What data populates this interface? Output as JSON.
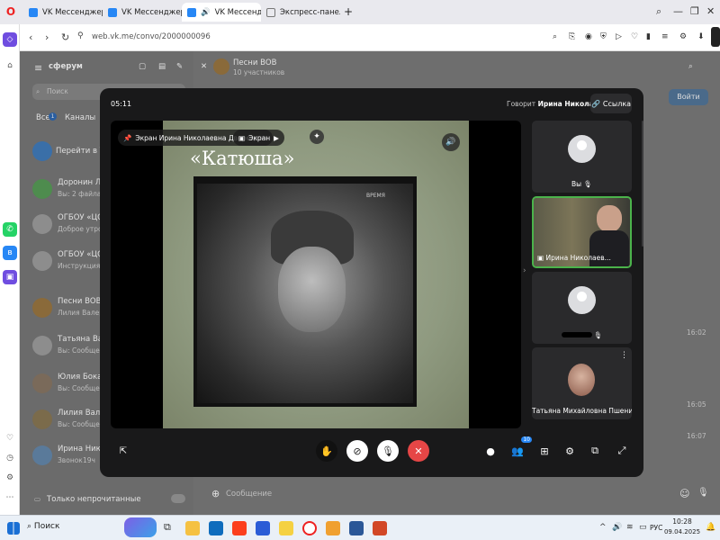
{
  "browser": {
    "tabs": [
      {
        "label": "VK Мессенджер"
      },
      {
        "label": "VK Мессенджер"
      },
      {
        "label": "VK Мессенджер"
      },
      {
        "label": "Экспресс-панель"
      }
    ],
    "url": "web.vk.me/convo/2000000096"
  },
  "vk": {
    "brand": "сферум",
    "search_placeholder": "Поиск",
    "filters": {
      "all": "Все",
      "all_count": "1",
      "channels": "Каналы"
    },
    "go_vk": "Перейти в VK М",
    "chats": [
      {
        "name": "Доронин Леон",
        "preview": "Вы: 2 файла",
        "time": ""
      },
      {
        "name": "ОГБОУ «ЦОДТ",
        "preview": "Доброе утро, у",
        "time": ""
      },
      {
        "name": "ОГБОУ «ЦОДТ",
        "preview": "Инструкция по",
        "time": ""
      },
      {
        "name": "Песни ВОВ",
        "preview": "Лилия Валерья",
        "time": ""
      },
      {
        "name": "Татьяна Васил",
        "preview": "Вы: Сообщени",
        "time": ""
      },
      {
        "name": "Юлия Боканов",
        "preview": "Вы: Сообщени",
        "time": ""
      },
      {
        "name": "Лилия Валерь",
        "preview": "Вы: Сообщени",
        "time": ""
      },
      {
        "name": "Ирина Никола",
        "preview": "Звонок",
        "time": "19ч"
      }
    ],
    "unread_toggle": "Только непрочитанные",
    "chat_header": {
      "title": "Песни ВОВ",
      "subtitle": "10 участников"
    },
    "join_button": "Войти",
    "message_placeholder": "Сообщение",
    "msg_times": [
      "16:02",
      "16:05",
      "16:07"
    ]
  },
  "call": {
    "timer": "05:11",
    "speaking_prefix": "Говорит",
    "speaking_name": "Ирина Николаевна Д.",
    "link_button": "Ссылка",
    "screen_pill": "Экран Ирина Николаевна Дворецкая",
    "screen_pill2": "Экран",
    "slide_title": "«Катюша»",
    "watermark": "ВРЕМЯ",
    "participants": [
      {
        "name": "Вы"
      },
      {
        "name": "Ирина Николаев..."
      },
      {
        "name": ""
      },
      {
        "name": "Татьяна Михайловна Пшенина"
      }
    ],
    "chat_badge": "10"
  },
  "taskbar": {
    "search": "Поиск",
    "lang": "РУС",
    "time": "10:28",
    "date": "09.04.2025"
  },
  "colors": {
    "accent": "#2787f5",
    "end_call": "#e64646",
    "active_speaker": "#4bb34b"
  }
}
